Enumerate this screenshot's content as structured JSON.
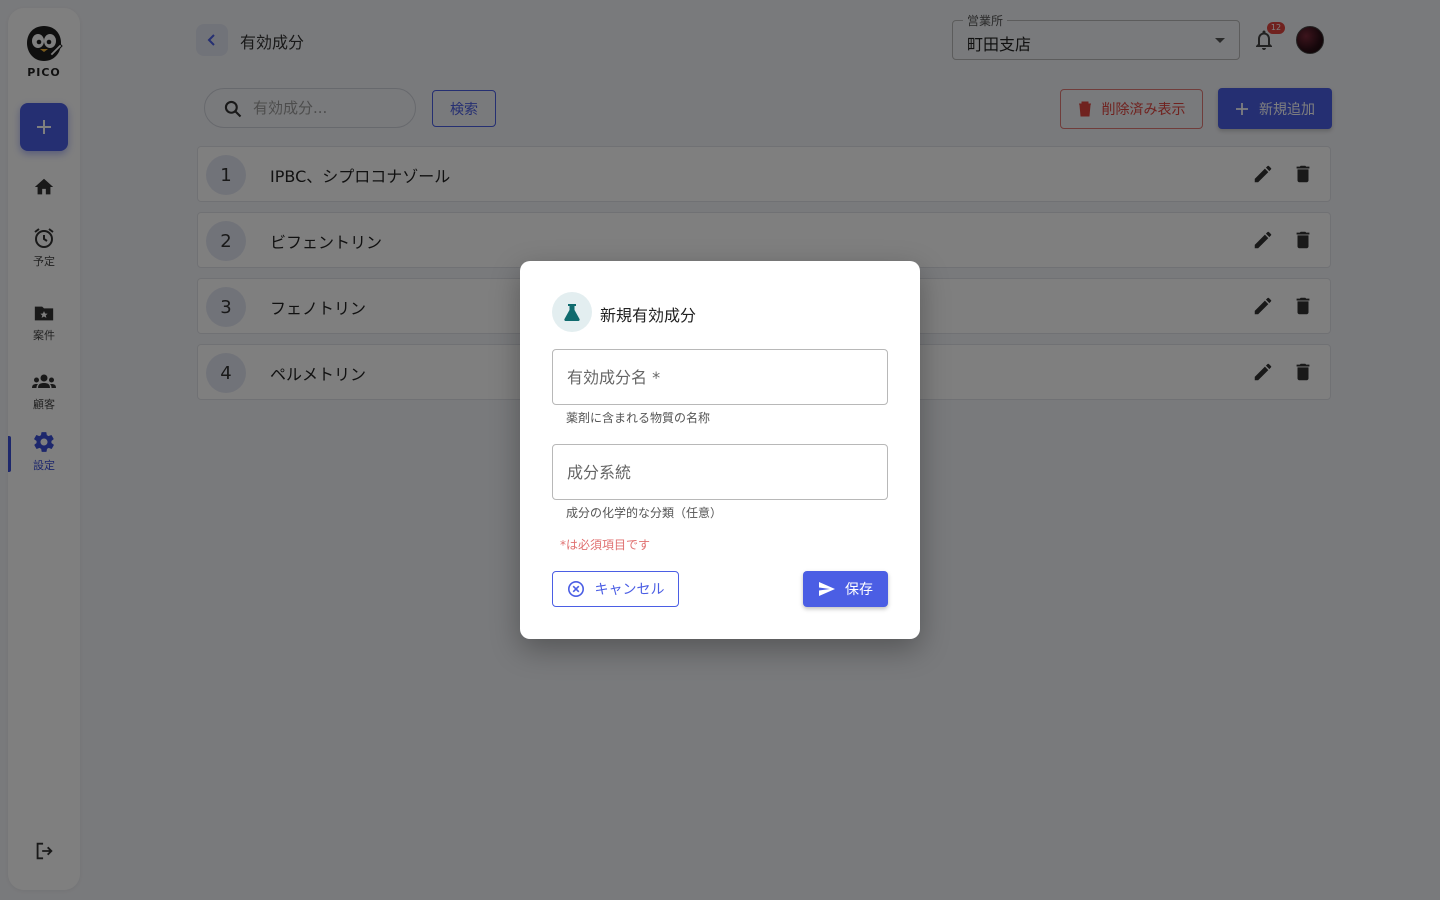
{
  "app": {
    "logo_text": "PICO"
  },
  "sidebar": {
    "items": [
      {
        "name": "home",
        "label": ""
      },
      {
        "name": "schedule",
        "label": "予定"
      },
      {
        "name": "projects",
        "label": "案件"
      },
      {
        "name": "customers",
        "label": "顧客"
      },
      {
        "name": "settings",
        "label": "設定",
        "active": true
      }
    ]
  },
  "header": {
    "title": "有効成分",
    "office": {
      "label": "営業所",
      "value": "町田支店"
    },
    "notifications": {
      "count": "12"
    }
  },
  "toolbar": {
    "search_placeholder": "有効成分...",
    "search_button": "検索",
    "show_deleted_button": "削除済み表示",
    "add_button": "新規追加"
  },
  "list": {
    "rows": [
      {
        "num": "1",
        "name": "IPBC、シプロコナゾール"
      },
      {
        "num": "2",
        "name": "ビフェントリン"
      },
      {
        "num": "3",
        "name": "フェノトリン"
      },
      {
        "num": "4",
        "name": "ペルメトリン"
      }
    ]
  },
  "dialog": {
    "title": "新規有効成分",
    "name_field": {
      "placeholder": "有効成分名 *",
      "value": "",
      "helper": "薬剤に含まれる物質の名称"
    },
    "category_field": {
      "placeholder": "成分系統",
      "value": "",
      "helper": "成分の化学的な分類（任意）"
    },
    "required_note": "*は必須項目です",
    "cancel_button": "キャンセル",
    "save_button": "保存"
  },
  "colors": {
    "primary": "#4b5ee4",
    "danger": "#e0443e",
    "icon_teal": "#0f6b6e",
    "background": "#f3f4f8"
  }
}
